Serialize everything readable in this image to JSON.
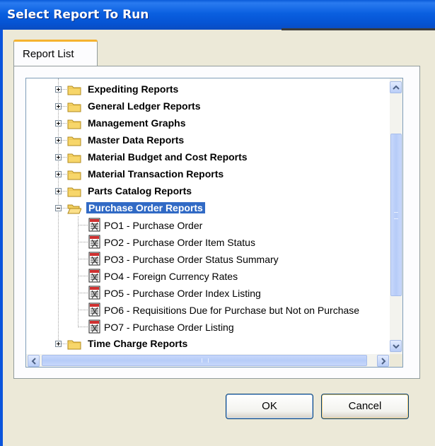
{
  "window": {
    "title": "Select Report To Run"
  },
  "tabs": [
    {
      "label": "Report List"
    }
  ],
  "tree": {
    "folders_before": [
      {
        "label": "Expediting Reports",
        "expanded": false
      },
      {
        "label": "General Ledger Reports",
        "expanded": false
      },
      {
        "label": "Management Graphs",
        "expanded": false
      },
      {
        "label": "Master Data Reports",
        "expanded": false
      },
      {
        "label": "Material Budget and Cost Reports",
        "expanded": false
      },
      {
        "label": "Material Transaction Reports",
        "expanded": false
      },
      {
        "label": "Parts Catalog Reports",
        "expanded": false
      }
    ],
    "selected_folder": {
      "label": "Purchase Order Reports",
      "expanded": true
    },
    "reports": [
      {
        "label": "PO1 -  Purchase Order"
      },
      {
        "label": "PO2 -  Purchase Order  Item Status"
      },
      {
        "label": "PO3 - Purchase Order  Status Summary"
      },
      {
        "label": "PO4 -  Foreign Currency Rates"
      },
      {
        "label": "PO5 - Purchase Order  Index Listing"
      },
      {
        "label": "PO6 - Requisitions Due for Purchase but Not on Purchase"
      },
      {
        "label": "PO7 - Purchase Order Listing"
      }
    ],
    "folders_after": [
      {
        "label": "Time Charge Reports",
        "expanded": false
      }
    ]
  },
  "buttons": {
    "ok": "OK",
    "cancel": "Cancel"
  },
  "icons": {
    "expand": "plus-box-icon",
    "collapse": "minus-box-icon",
    "folder": "folder-icon",
    "open_folder": "open-folder-icon",
    "report": "report-document-icon"
  },
  "colors": {
    "title_bar": "#0A5FE0",
    "selection": "#316AC5",
    "tab_accent": "#F5B330",
    "dialog_bg": "#ECE9D8"
  }
}
